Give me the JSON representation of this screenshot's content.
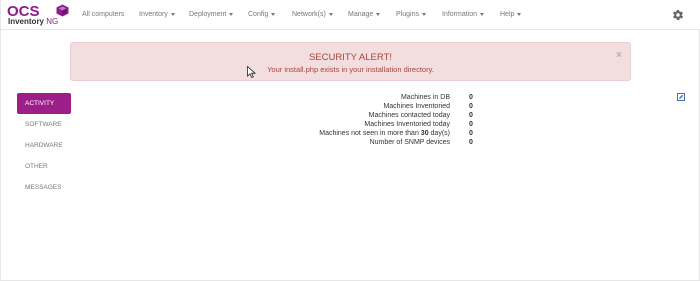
{
  "brand": {
    "logo_text_ocs": "OCS",
    "logo_text_inventory": "Inventory",
    "logo_text_ng": "NG"
  },
  "navbar": {
    "items": [
      {
        "label": "All computers",
        "dropdown": false
      },
      {
        "label": "Inventory",
        "dropdown": true
      },
      {
        "label": "Deployment",
        "dropdown": true
      },
      {
        "label": "Config",
        "dropdown": true
      },
      {
        "label": "Network(s)",
        "dropdown": true
      },
      {
        "label": "Manage",
        "dropdown": true
      },
      {
        "label": "Plugins",
        "dropdown": true
      },
      {
        "label": "Information",
        "dropdown": true
      },
      {
        "label": "Help",
        "dropdown": true
      }
    ],
    "settings_icon": "gear-icon"
  },
  "alert": {
    "title": "SECURITY ALERT!",
    "message": "Your install.php exists in your installation directory.",
    "close_label": "×",
    "background": "#f2dede",
    "text_color": "#a94442"
  },
  "sidebar": {
    "items": [
      {
        "label": "ACTIVITY",
        "active": true
      },
      {
        "label": "SOFTWARE",
        "active": false
      },
      {
        "label": "HARDWARE",
        "active": false
      },
      {
        "label": "OTHER",
        "active": false
      },
      {
        "label": "MESSAGES",
        "active": false
      }
    ],
    "accent_color": "#9c1f89"
  },
  "stats": [
    {
      "label": "Machines in DB",
      "value": "0"
    },
    {
      "label": "Machines Inventoried",
      "value": "0"
    },
    {
      "label": "Machines contacted today",
      "value": "0"
    },
    {
      "label": "Machines Inventoried today",
      "value": "0"
    },
    {
      "label_prefix": "Machines not seen in more than ",
      "label_bold": "30",
      "label_suffix": " day(s)",
      "value": "0"
    },
    {
      "label": "Number of SNMP devices",
      "value": "0"
    }
  ],
  "edit_icon": "edit-icon"
}
